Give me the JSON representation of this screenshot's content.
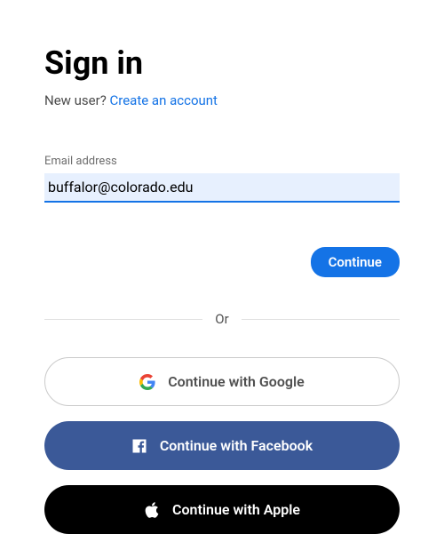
{
  "heading": "Sign in",
  "new_user_text": "New user? ",
  "create_account_link": "Create an account",
  "email": {
    "label": "Email address",
    "value": "buffalor@colorado.edu"
  },
  "continue_label": "Continue",
  "divider_text": "Or",
  "social": {
    "google": "Continue with Google",
    "facebook": "Continue with Facebook",
    "apple": "Continue with Apple"
  },
  "colors": {
    "primary": "#1473e6",
    "facebook": "#3b5998",
    "apple": "#000000"
  }
}
